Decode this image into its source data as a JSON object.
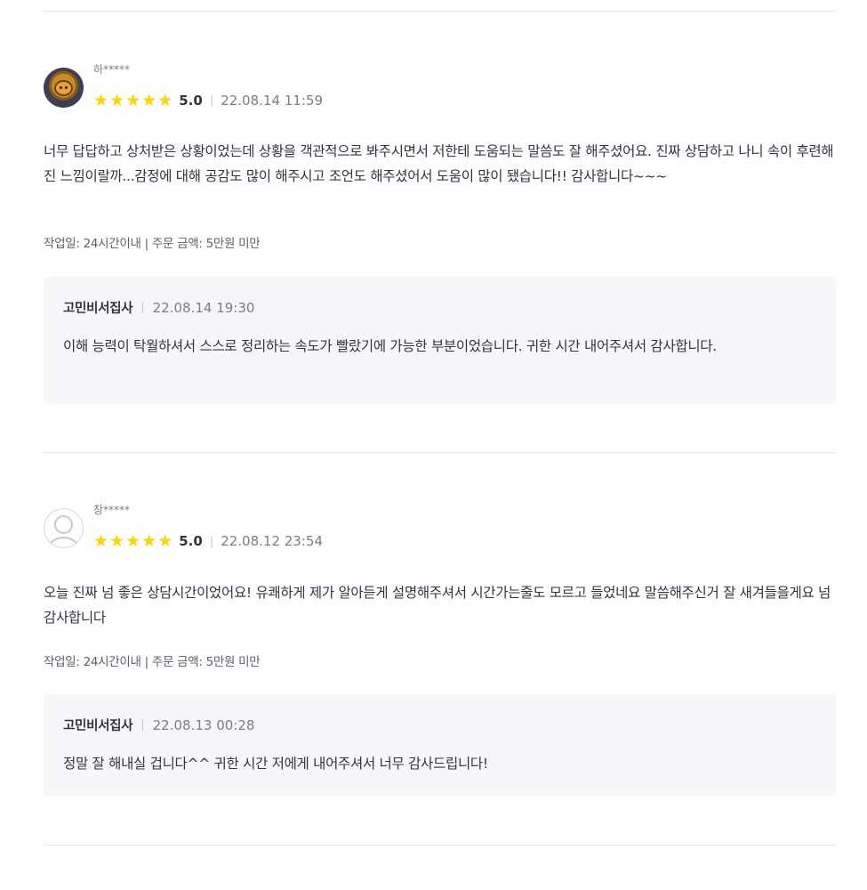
{
  "reviews": [
    {
      "nickname": "하*****",
      "stars": [
        "★",
        "★",
        "★",
        "★",
        "★"
      ],
      "score": "5.0",
      "separator": "|",
      "date": "22.08.14 11:59",
      "text": "너무 답답하고 상처받은 상황이었는데 상황을 객관적으로 봐주시면서 저한테 도움되는 말씀도 잘 해주셨어요. 진짜 상담하고 나니 속이 후련해진 느낌이랄까...감정에 대해 공감도 많이 해주시고 조언도 해주셨어서 도움이 많이 됐습니다!! 감사합니다~~~",
      "meta": "작업일: 24시간이내 | 주문 금액: 5만원 미만",
      "reply": {
        "author": "고민비서집사",
        "separator": "|",
        "date": "22.08.14 19:30",
        "text": "이해 능력이 탁월하셔서 스스로 정리하는 속도가 빨랐기에 가능한 부분이었습니다. 귀한 시간 내어주셔서 감사합니다."
      }
    },
    {
      "nickname": "창*****",
      "stars": [
        "★",
        "★",
        "★",
        "★",
        "★"
      ],
      "score": "5.0",
      "separator": "|",
      "date": "22.08.12 23:54",
      "text": "오늘 진짜 넘 좋은 상담시간이었어요! 유쾌하게 제가 알아듣게 설명해주셔서 시간가는줄도 모르고 들었네요 말씀해주신거 잘 새겨들을게요 넘 감사합니다",
      "meta": "작업일: 24시간이내 | 주문 금액: 5만원 미만",
      "reply": {
        "author": "고민비서집사",
        "separator": "|",
        "date": "22.08.13 00:28",
        "text": "정말 잘 해내실 겁니다^^ 귀한 시간 저에게 내어주셔서 너무 감사드립니다!"
      }
    }
  ],
  "colors": {
    "star": "#ffd400",
    "text": "#303441",
    "muted": "#7a7d89",
    "divider": "#e4e5ed",
    "reply_bg": "#f7f7fa"
  }
}
